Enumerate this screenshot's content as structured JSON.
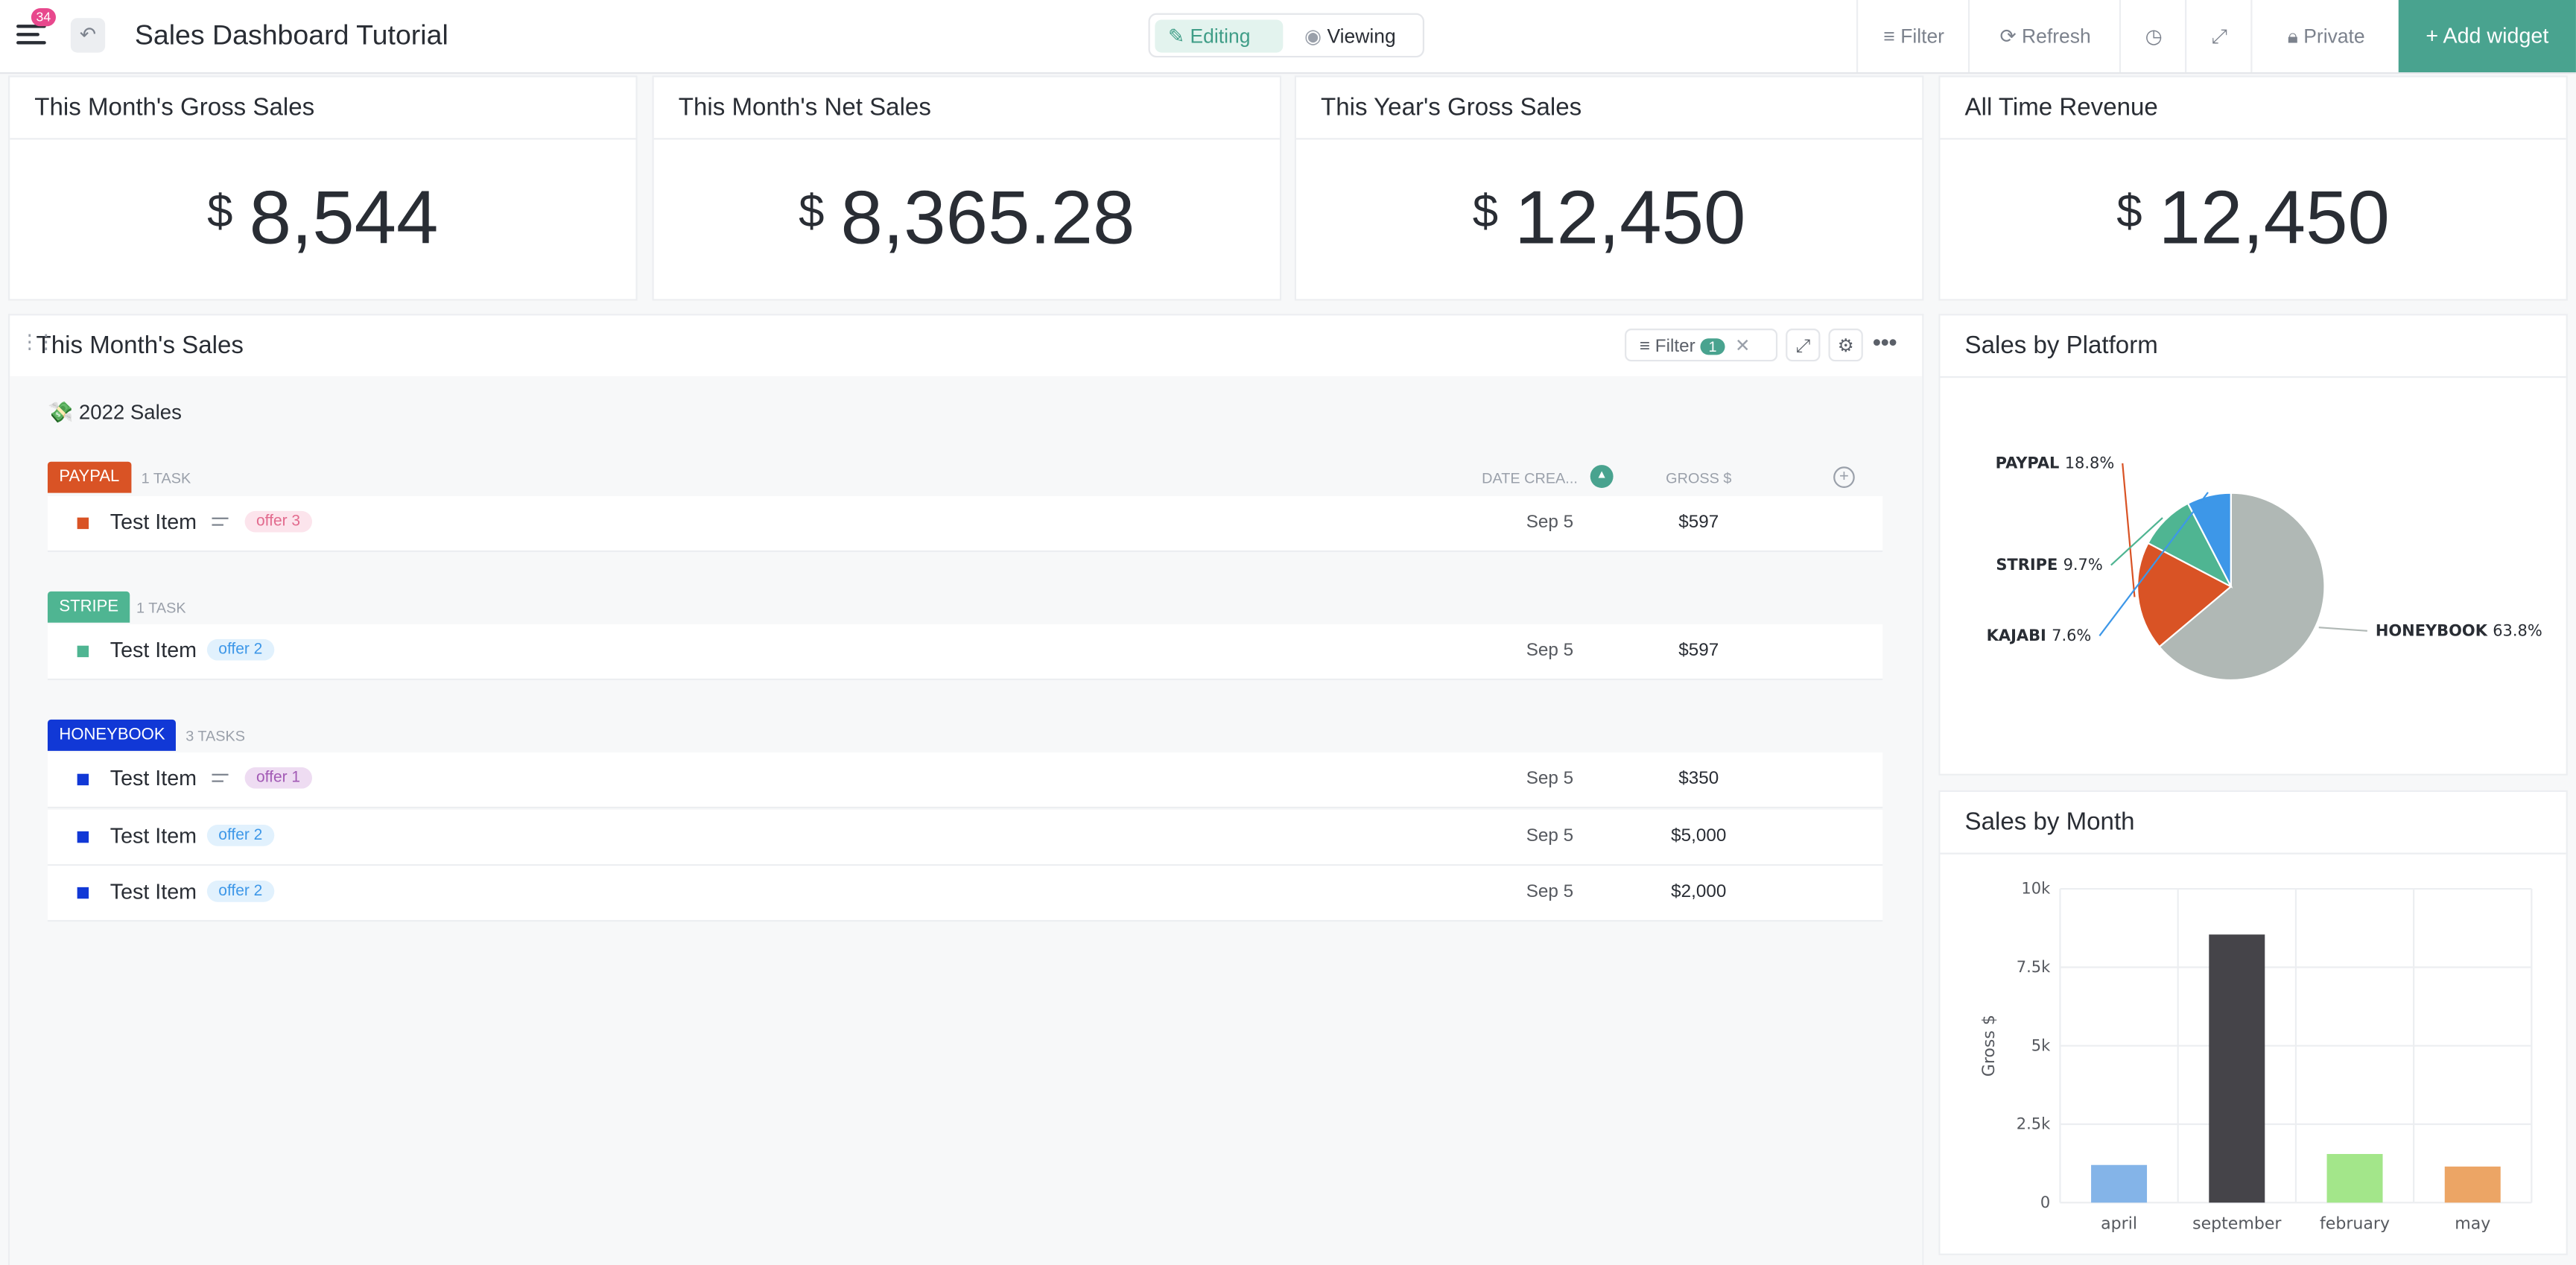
{
  "topbar": {
    "notif_count": "34",
    "title": "Sales Dashboard Tutorial",
    "mode_editing": "Editing",
    "mode_viewing": "Viewing",
    "filter": "Filter",
    "refresh": "Refresh",
    "private": "Private",
    "add_widget": "+ Add widget"
  },
  "kpis": [
    {
      "title": "This Month's Gross Sales",
      "currency": "$",
      "value": "8,544"
    },
    {
      "title": "This Month's Net Sales",
      "currency": "$",
      "value": "8,365.28"
    },
    {
      "title": "This Year's Gross Sales",
      "currency": "$",
      "value": "12,450"
    },
    {
      "title": "All Time Revenue",
      "currency": "$",
      "value": "12,450"
    }
  ],
  "sales": {
    "title": "This Month's Sales",
    "filter_label": "Filter",
    "filter_count": "1",
    "list_title": "💸 2022 Sales",
    "col_date": "DATE CREA...",
    "col_gross": "GROSS $",
    "groups": [
      {
        "name": "PAYPAL",
        "count": "1 TASK",
        "color": "#d95325",
        "rows": [
          {
            "name": "Test Item",
            "tag": "offer 3",
            "date": "Sep 5",
            "gross": "$597"
          }
        ]
      },
      {
        "name": "STRIPE",
        "count": "1 TASK",
        "color": "#4fb592",
        "rows": [
          {
            "name": "Test Item",
            "tag": "offer 2",
            "date": "Sep 5",
            "gross": "$597"
          }
        ]
      },
      {
        "name": "HONEYBOOK",
        "count": "3 TASKS",
        "color": "#1138d6",
        "rows": [
          {
            "name": "Test Item",
            "tag": "offer 1",
            "date": "Sep 5",
            "gross": "$350"
          },
          {
            "name": "Test Item",
            "tag": "offer 2",
            "date": "Sep 5",
            "gross": "$5,000"
          },
          {
            "name": "Test Item",
            "tag": "offer 2",
            "date": "Sep 5",
            "gross": "$2,000"
          }
        ]
      }
    ]
  },
  "platform": {
    "title": "Sales by Platform"
  },
  "month": {
    "title": "Sales by Month"
  },
  "chart_data": [
    {
      "type": "pie",
      "title": "Sales by Platform",
      "categories": [
        "HONEYBOOK",
        "PAYPAL",
        "STRIPE",
        "KAJABI"
      ],
      "values": [
        63.8,
        18.8,
        9.7,
        7.6
      ],
      "labels": [
        "63.8%",
        "18.8%",
        "9.7%",
        "7.6%"
      ],
      "colors": [
        "#b0b8b5",
        "#d95325",
        "#4fb592",
        "#3d97e8"
      ]
    },
    {
      "type": "bar",
      "title": "Sales by Month",
      "categories": [
        "april",
        "september",
        "february",
        "may"
      ],
      "values": [
        1200,
        8544,
        1550,
        1150
      ],
      "colors": [
        "#84b4e8",
        "#454449",
        "#a3e68a",
        "#eca565"
      ],
      "ylabel": "Gross $",
      "ylim": [
        0,
        10000
      ],
      "yticks": [
        "0",
        "2.5k",
        "5k",
        "7.5k",
        "10k"
      ],
      "grid": true
    }
  ]
}
